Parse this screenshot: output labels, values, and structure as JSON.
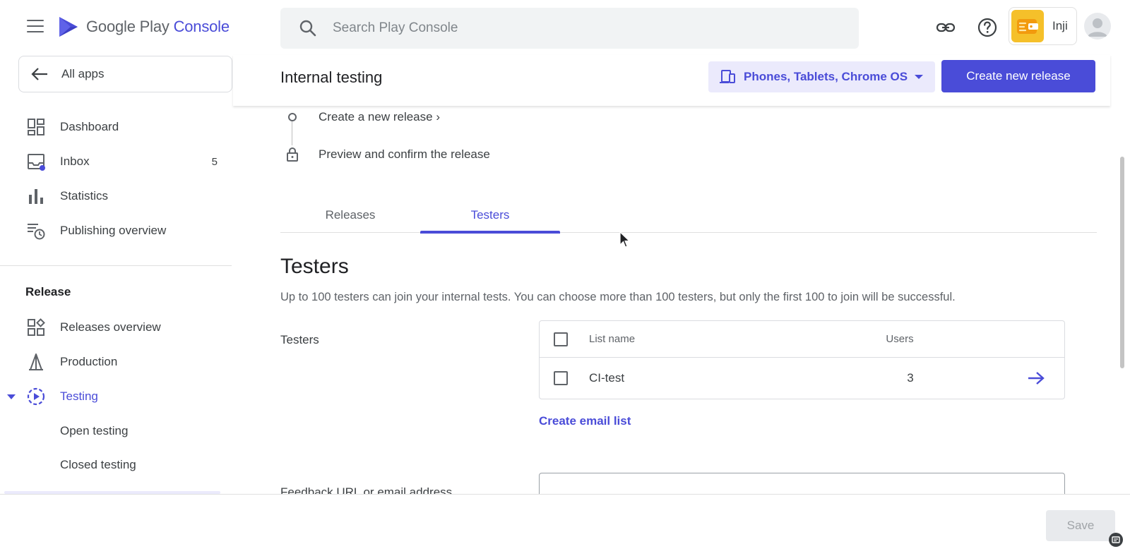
{
  "header": {
    "logo_text_main": "Google Play",
    "logo_text_console": "Console",
    "search_placeholder": "Search Play Console",
    "developer_name": "Inji"
  },
  "sidebar": {
    "all_apps_label": "All apps",
    "items": [
      {
        "label": "Dashboard",
        "icon": "dashboard-icon"
      },
      {
        "label": "Inbox",
        "icon": "inbox-icon",
        "count": "5"
      },
      {
        "label": "Statistics",
        "icon": "bar-chart-icon"
      },
      {
        "label": "Publishing overview",
        "icon": "publishing-overview-icon"
      }
    ],
    "release_section_label": "Release",
    "release_items": [
      {
        "label": "Releases overview",
        "icon": "releases-overview-icon"
      },
      {
        "label": "Production",
        "icon": "production-icon"
      },
      {
        "label": "Testing",
        "icon": "testing-icon",
        "active": true
      }
    ],
    "testing_sub_items": [
      {
        "label": "Open testing"
      },
      {
        "label": "Closed testing"
      }
    ]
  },
  "page": {
    "title": "Internal testing",
    "device_selector_label": "Phones, Tablets, Chrome OS",
    "create_release_label": "Create new release",
    "steps": [
      {
        "label": "Create a new release ›",
        "icon": "circle-step-icon"
      },
      {
        "label": "Preview and confirm the release",
        "icon": "lock-icon"
      }
    ],
    "tabs": [
      {
        "label": "Releases",
        "active": false
      },
      {
        "label": "Testers",
        "active": true
      }
    ],
    "testers_section": {
      "title": "Testers",
      "description": "Up to 100 testers can join your internal tests. You can choose more than 100 testers, but only the first 100 to join will be successful.",
      "field_label": "Testers",
      "table": {
        "columns": [
          "List name",
          "Users"
        ],
        "rows": [
          {
            "name": "CI-test",
            "users": "3"
          }
        ]
      },
      "create_list_label": "Create email list",
      "feedback_label": "Feedback URL or email address"
    }
  },
  "footer": {
    "save_label": "Save"
  },
  "colors": {
    "accent": "#4a4cd8",
    "accent_light": "#ebeafc",
    "text_primary": "#202124",
    "text_secondary": "#5f6368",
    "developer_avatar": "#f5c02a"
  }
}
